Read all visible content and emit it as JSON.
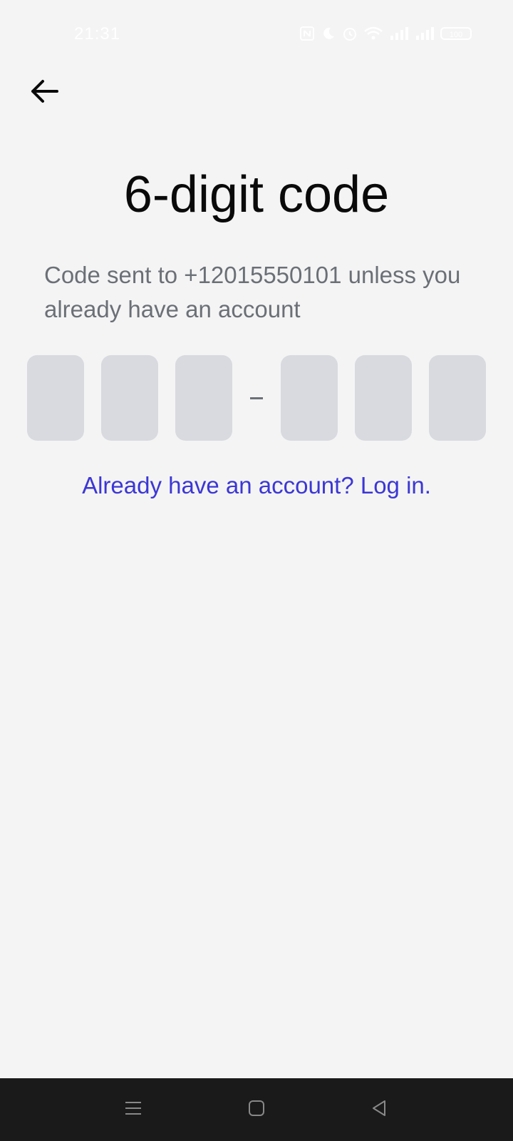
{
  "status_bar": {
    "time": "21:31",
    "battery": "100",
    "icons": [
      "nfc-icon",
      "moon-icon",
      "alarm-icon",
      "wifi-icon",
      "signal-icon",
      "signal-icon",
      "battery-icon"
    ]
  },
  "header": {
    "back_icon": "arrow-left-icon"
  },
  "main": {
    "title": "6-digit code",
    "subtitle": "Code sent to +12015550101 unless you already have an account",
    "code_separator": "-",
    "code_digits": [
      "",
      "",
      "",
      "",
      "",
      ""
    ],
    "login_link": "Already have an account? Log in."
  },
  "nav_bar": {
    "icons": [
      "menu-icon",
      "home-icon",
      "back-triangle-icon"
    ]
  },
  "colors": {
    "background": "#f4f4f4",
    "code_box": "#d8dadf",
    "link": "#3c37d5",
    "subtitle": "#6b7077",
    "nav_bar": "#1a1a1a"
  }
}
